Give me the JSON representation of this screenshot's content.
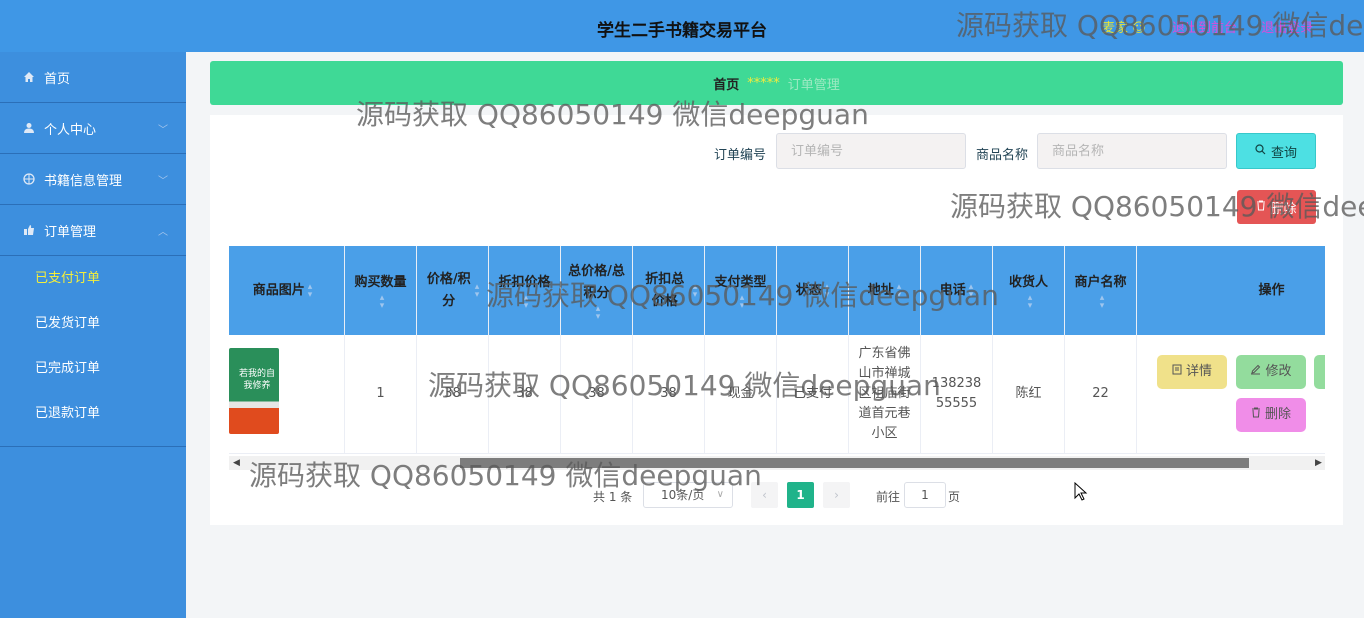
{
  "header": {
    "title": "学生二手书籍交易平台",
    "user": "麦家 ☺",
    "link_front": "退出到前台",
    "link_logout": "退出登录"
  },
  "sidebar": {
    "home": "首页",
    "personal": "个人中心",
    "books": "书籍信息管理",
    "orders": "订单管理",
    "sub": [
      "已支付订单",
      "已发货订单",
      "已完成订单",
      "已退款订单"
    ]
  },
  "breadcrumb": {
    "home": "首页",
    "sep": "*****",
    "current": "订单管理"
  },
  "search": {
    "order_no_label": "订单编号",
    "order_no_placeholder": "订单编号",
    "order_no_value": "",
    "goods_label": "商品名称",
    "goods_placeholder": "商品名称",
    "goods_value": "",
    "search_btn": "查询",
    "delete_btn": "删除"
  },
  "table": {
    "headers": [
      "商品图片",
      "购买数量",
      "价格/积分",
      "折扣价格",
      "总价格/总积分",
      "折扣总价格",
      "支付类型",
      "状态",
      "地址",
      "电话",
      "收货人",
      "商户名称",
      "操作"
    ],
    "row": {
      "image_text": "若我的自我修养",
      "qty": "1",
      "price": "38",
      "discount_price": "38",
      "total": "38",
      "discount_total": "38",
      "pay_type": "现金",
      "status": "已支付",
      "address": "广东省佛山市禅城区祖庙街道首元巷小区",
      "phone": "13823855555",
      "receiver": "陈红",
      "merchant": "22",
      "btn_detail": "详情",
      "btn_edit": "修改",
      "btn_delete": "删除"
    }
  },
  "pagination": {
    "total": "共 1 条",
    "page_size": "10条/页",
    "current": "1",
    "goto_label": "前往",
    "goto_value": "1",
    "page_unit": "页"
  },
  "watermark": "源码获取 QQ86050149 微信deepguan",
  "icons": {
    "home": "home-icon",
    "user": "user-icon",
    "book": "book-icon",
    "order": "order-icon"
  },
  "colors": {
    "header": "#3f97e6",
    "sidebar": "#3d8fde",
    "breadcrumb": "#3fd996",
    "table_header": "#4a9fe8",
    "search_btn": "#4de0e3",
    "delete_btn": "#e45555",
    "detail_btn": "#f0e18a",
    "edit_btn": "#93dc9d",
    "row_delete_btn": "#f08de8",
    "page_active": "#20b38a"
  }
}
